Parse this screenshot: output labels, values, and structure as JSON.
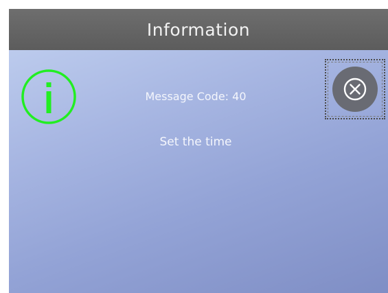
{
  "dialog": {
    "title": "Information",
    "message_code": "Message Code: 40",
    "message": "Set the time"
  },
  "icons": {
    "info": "info-icon",
    "close": "close-circle-x-icon"
  },
  "colors": {
    "header_bg": "#636363",
    "content_bg": "#9eaddd",
    "info_accent": "#22ee22",
    "close_button_bg": "#696b73",
    "text": "#f4f6fc"
  }
}
